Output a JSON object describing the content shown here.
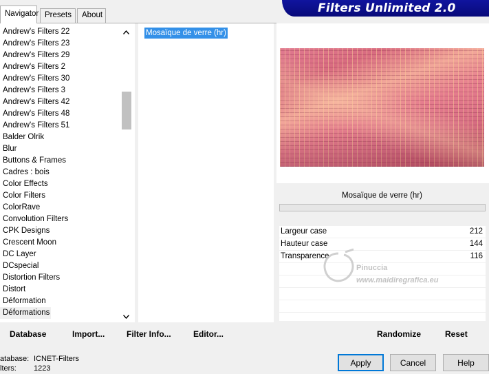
{
  "tabs": [
    {
      "label": "Navigator",
      "active": true
    },
    {
      "label": "Presets",
      "active": false
    },
    {
      "label": "About",
      "active": false
    }
  ],
  "banner": {
    "title": "Filters Unlimited 2.0"
  },
  "categories": [
    "Andrew's Filters 22",
    "Andrew's Filters 23",
    "Andrew's Filters 29",
    "Andrew's Filters 2",
    "Andrew's Filters 30",
    "Andrew's Filters 3",
    "Andrew's Filters 42",
    "Andrew's Filters 48",
    "Andrew's Filters 51",
    "Balder Olrik",
    "Blur",
    "Buttons & Frames",
    "Cadres : bois",
    "Color Effects",
    "Color Filters",
    "ColorRave",
    "Convolution Filters",
    "CPK Designs",
    "Crescent Moon",
    "DC Layer",
    "DCspecial",
    "Distortion Filters",
    "Distort",
    "Déformation",
    "Déformations"
  ],
  "selected_category": "Déformations",
  "filters": [
    "Mosaïque de verre (hr)"
  ],
  "selected_filter": "Mosaïque de verre (hr)",
  "filter_title": "Mosaïque de verre (hr)",
  "params": [
    {
      "label": "Largeur case",
      "value": "212"
    },
    {
      "label": "Hauteur case",
      "value": "144"
    },
    {
      "label": "Transparence",
      "value": "116"
    }
  ],
  "toolbar": {
    "database": "Database",
    "import": "Import...",
    "filter_info": "Filter Info...",
    "editor": "Editor...",
    "randomize": "Randomize",
    "reset": "Reset"
  },
  "status": {
    "database_label": "atabase:",
    "database_value": "ICNET-Filters",
    "filters_label": "lters:",
    "filters_value": "1223"
  },
  "buttons": {
    "apply": "Apply",
    "cancel": "Cancel",
    "help": "Help"
  },
  "watermark": {
    "line1": "Pinuccia",
    "line2": "www.maidiregrafica.eu"
  },
  "colors": {
    "selection": "#3390e8",
    "banner": "#0b0f8a",
    "primary_border": "#0078d7"
  }
}
